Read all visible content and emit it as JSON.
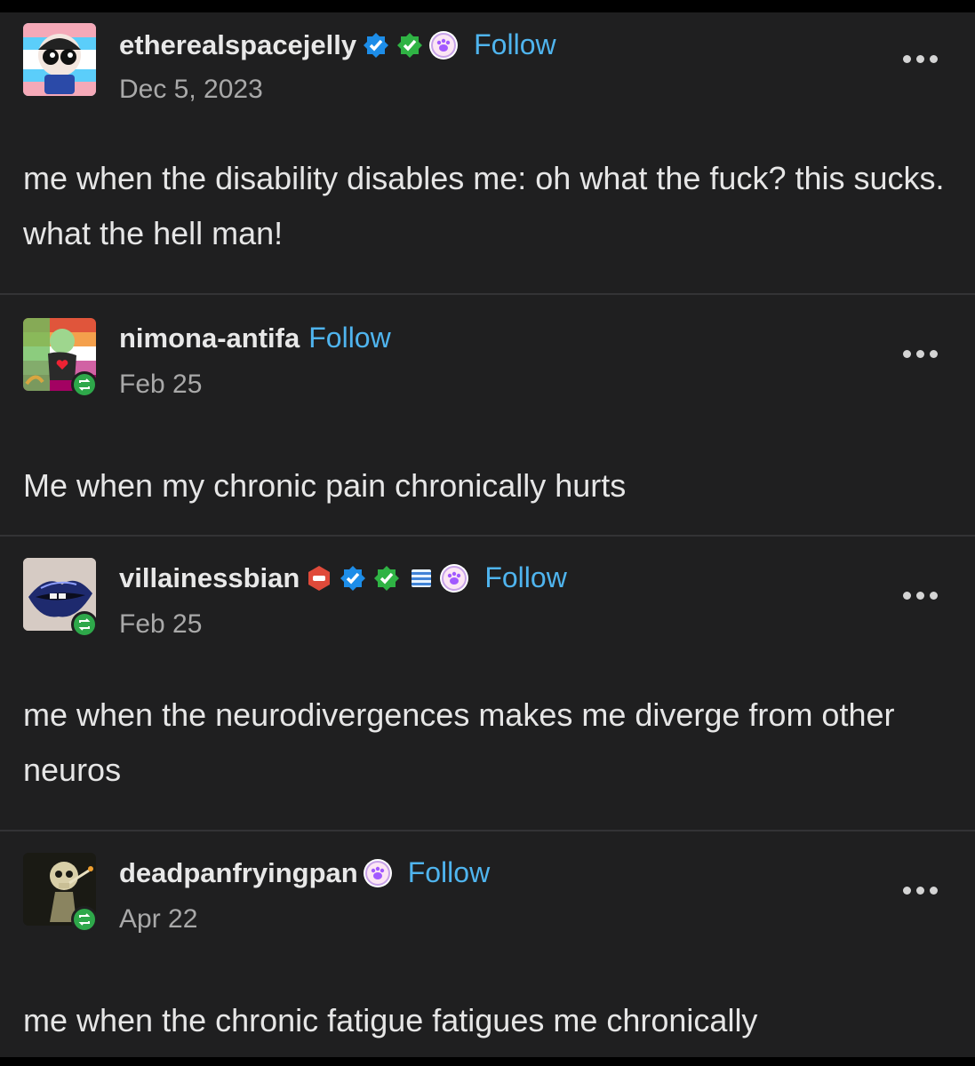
{
  "posts": [
    {
      "username": "etherealspacejelly",
      "follow_label": "Follow",
      "date": "Dec 5, 2023",
      "text": "me when the disability disables me: oh what the fuck? this sucks. what the hell man!"
    },
    {
      "username": "nimona-antifa",
      "follow_label": "Follow",
      "date": "Feb 25",
      "text": "Me when my chronic pain chronically hurts"
    },
    {
      "username": "villainessbian",
      "follow_label": "Follow",
      "date": "Feb 25",
      "text": "me when the neurodivergences makes me diverge from other neuros"
    },
    {
      "username": "deadpanfryingpan",
      "follow_label": "Follow",
      "date": "Apr 22",
      "text": "me when the chronic fatigue fatigues me chronically"
    }
  ],
  "colors": {
    "background": "#1f1f20",
    "follow": "#4fb4ee",
    "reblog_badge": "#2ea84a",
    "verified_blue": "#1d8de8",
    "verified_green": "#2fb344",
    "paw_purple": "#a259ff"
  },
  "icons": [
    "verified-badge-icon",
    "green-check-badge-icon",
    "paw-badge-icon",
    "reblog-icon",
    "more-options-icon"
  ]
}
